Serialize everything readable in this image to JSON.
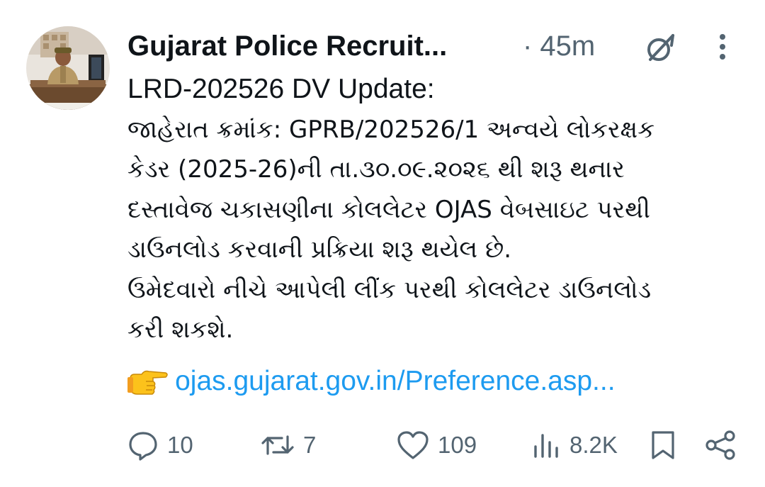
{
  "post": {
    "author": "Gujarat Police Recruit...",
    "time": "· 45m",
    "lines": [
      "LRD-202526 DV Update:",
      "જાહેરાત ક્રમાંક: GPRB/202526/1 અન્વયે લોકરક્ષક",
      "કેડર (2025-26)ની તા.૩૦.૦૯.૨૦૨૬ થી શરૂ થનાર",
      "દસ્તાવેજ ચકાસણીના કોલલેટર OJAS વેબસાઇટ પરથી",
      "ડાઉનલોડ કરવાની પ્રક્રિયા શરૂ થયેલ છે.",
      "ઉમેદવારો નીચે આપેલી લીંક પરથી કોલલેટર ડાઉનલોડ",
      "કરી શકશે."
    ],
    "link_text": "ojas.gujarat.gov.in/Preference.asp..."
  },
  "actions": {
    "replies": "10",
    "reposts": "7",
    "likes": "109",
    "views": "8.2K"
  },
  "icons": {
    "reply": "reply-icon",
    "repost": "repost-icon",
    "like": "heart-icon",
    "views": "views-icon",
    "bookmark": "bookmark-icon",
    "share": "share-icon",
    "grok": "grok-icon",
    "more": "more-vertical-icon",
    "pointing": "pointing-right-hand-icon"
  },
  "colors": {
    "text": "#0f1419",
    "secondary": "#536471",
    "link": "#1d9bf0"
  }
}
